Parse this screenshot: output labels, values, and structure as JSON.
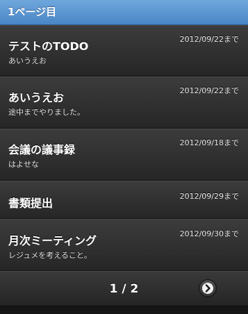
{
  "header": {
    "title": "1ページ目"
  },
  "items": [
    {
      "title": "テストのTODO",
      "subtitle": "あいうえお",
      "date": "2012/09/22まで"
    },
    {
      "title": "あいうえお",
      "subtitle": "途中までやりました。",
      "date": "2012/09/22まで"
    },
    {
      "title": "会議の議事録",
      "subtitle": "はよせな",
      "date": "2012/09/18まで"
    },
    {
      "title": "書類提出",
      "subtitle": "",
      "date": "2012/09/29まで"
    },
    {
      "title": "月次ミーティング",
      "subtitle": "レジュメを考えること。",
      "date": "2012/09/30まで"
    }
  ],
  "pagination": {
    "label": "1 / 2",
    "next_icon": "chevron-right-icon"
  }
}
